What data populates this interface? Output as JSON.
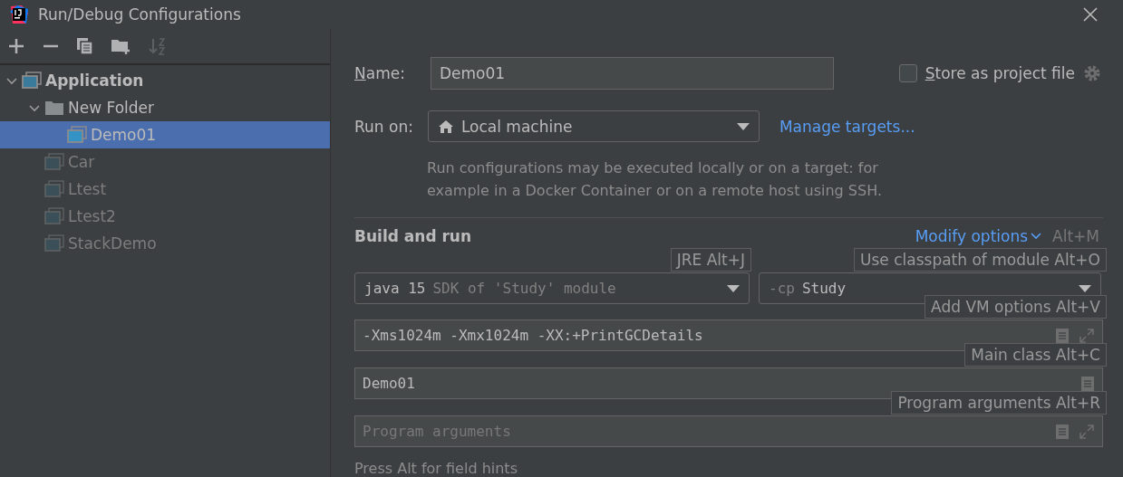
{
  "window": {
    "title": "Run/Debug Configurations"
  },
  "toolbar": [
    {
      "kind": "add",
      "disabled": false
    },
    {
      "kind": "remove",
      "disabled": false
    },
    {
      "kind": "copy",
      "disabled": false
    },
    {
      "kind": "folder",
      "disabled": false
    },
    {
      "kind": "sort",
      "disabled": true
    }
  ],
  "tree": [
    {
      "label": "Application",
      "kind": "group",
      "expanded": true,
      "selected": false,
      "dimmed": false,
      "children": [
        {
          "label": "New Folder",
          "kind": "folder",
          "expanded": true,
          "selected": false,
          "dimmed": false,
          "children": [
            {
              "label": "Demo01",
              "kind": "config",
              "selected": true,
              "dimmed": false
            }
          ]
        },
        {
          "label": "Car",
          "kind": "config",
          "selected": false,
          "dimmed": true
        },
        {
          "label": "Ltest",
          "kind": "config",
          "selected": false,
          "dimmed": true
        },
        {
          "label": "Ltest2",
          "kind": "config",
          "selected": false,
          "dimmed": true
        },
        {
          "label": "StackDemo",
          "kind": "config",
          "selected": false,
          "dimmed": true
        }
      ]
    }
  ],
  "name": {
    "label": "Name:",
    "value": "Demo01"
  },
  "store": {
    "label": "Store as project file",
    "checked": false
  },
  "run_on": {
    "label": "Run on:",
    "value": "Local machine",
    "link": "Manage targets..."
  },
  "description": "Run configurations may be executed locally or on a target: for\nexample in a Docker Container or on a remote host using SSH.",
  "build": {
    "title": "Build and run",
    "modify": "Modify options",
    "modify_shortcut": "Alt+M"
  },
  "jdk": {
    "value": "java 15",
    "detail": "SDK of 'Study' module",
    "hint": "JRE Alt+J"
  },
  "classpath": {
    "prefix": "-cp",
    "value": "Study",
    "hint": "Use classpath of module Alt+O"
  },
  "fields": [
    {
      "value": "-Xms1024m -Xmx1024m -XX:+PrintGCDetails",
      "hint": "Add VM options Alt+V",
      "expand": true
    },
    {
      "value": "Demo01",
      "hint": "Main class Alt+C",
      "expand": false
    },
    {
      "placeholder": "Program arguments",
      "hint": "Program arguments Alt+R",
      "expand": true
    }
  ],
  "footer": "Press Alt for field hints"
}
